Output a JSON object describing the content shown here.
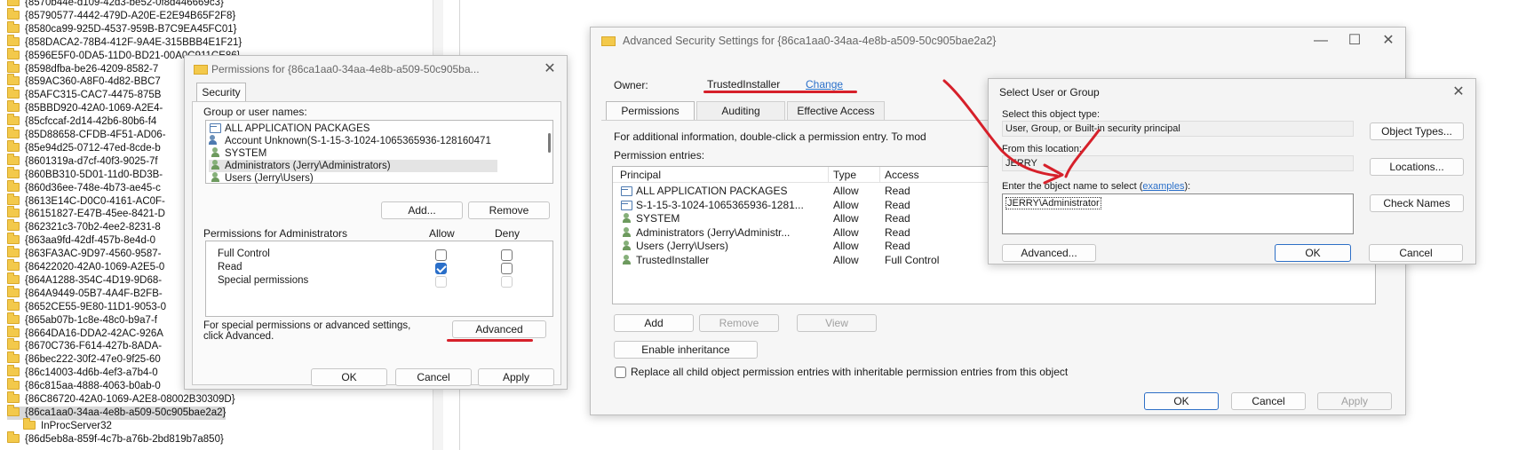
{
  "tree": {
    "rows": [
      "{8570b44e-d109-42d3-be52-0f8d446669c3}",
      "{85790577-4442-479D-A20E-E2E94B65F2F8}",
      "{8580ca99-925D-4537-959B-B7C9EA45FC01}",
      "{858DACA2-78B4-412F-9A4E-315BBB4E1F21}",
      "{8596E5F0-0DA5-11D0-BD21-00A0C911CE86}",
      "{8598dfba-be26-4209-8582-7",
      "{859AC360-A8F0-4d82-BBC7",
      "{85AFC315-CAC7-4475-875B",
      "{85BBD920-42A0-1069-A2E4-",
      "{85cfccaf-2d14-42b6-80b6-f4",
      "{85D88658-CFDB-4F51-AD06-",
      "{85e94d25-0712-47ed-8cde-b",
      "{8601319a-d7cf-40f3-9025-7f",
      "{860BB310-5D01-11d0-BD3B-",
      "{860d36ee-748e-4b73-ae45-c",
      "{8613E14C-D0C0-4161-AC0F-",
      "{86151827-E47B-45ee-8421-D",
      "{862321c3-70b2-4ee2-8231-8",
      "{863aa9fd-42df-457b-8e4d-0",
      "{863FA3AC-9D97-4560-9587-",
      "{86422020-42A0-1069-A2E5-0",
      "{864A1288-354C-4D19-9D68-",
      "{864A9449-05B7-4A4F-B2FB-",
      "{8652CE55-9E80-11D1-9053-0",
      "{865ab07b-1c8e-48c0-b9a7-f",
      "{8664DA16-DDA2-42AC-926A",
      "{8670C736-F614-427b-8ADA-",
      "{86bec222-30f2-47e0-9f25-60",
      "{86c14003-4d6b-4ef3-a7b4-0",
      "{86c815aa-4888-4063-b0ab-0",
      "{86C86720-42A0-1069-A2E8-08002B30309D}",
      "{86ca1aa0-34aa-4e8b-a509-50c905bae2a2}",
      "InProcServer32",
      "{86d5eb8a-859f-4c7b-a76b-2bd819b7a850}"
    ],
    "selected_index": 31,
    "child_index": 32
  },
  "permissions_dialog": {
    "title": "Permissions for {86ca1aa0-34aa-4e8b-a509-50c905ba...",
    "tab": "Security",
    "group_label": "Group or user names:",
    "users": [
      {
        "name": "ALL APPLICATION PACKAGES",
        "icon": "package-icon"
      },
      {
        "name": "Account Unknown(S-1-15-3-1024-1065365936-128160471",
        "icon": "user-icon"
      },
      {
        "name": "SYSTEM",
        "icon": "group-icon"
      },
      {
        "name": "Administrators (Jerry\\Administrators)",
        "icon": "group-icon"
      },
      {
        "name": "Users (Jerry\\Users)",
        "icon": "group-icon"
      }
    ],
    "add_label": "Add...",
    "remove_label": "Remove",
    "perm_header": "Permissions for Administrators",
    "allow_header": "Allow",
    "deny_header": "Deny",
    "permissions": [
      {
        "name": "Full Control",
        "allow": false,
        "deny": false,
        "dim": false
      },
      {
        "name": "Read",
        "allow": true,
        "deny": false,
        "dim": false
      },
      {
        "name": "Special permissions",
        "allow": false,
        "deny": false,
        "dim": true
      }
    ],
    "special_text_1": "For special permissions or advanced settings,",
    "special_text_2": "click Advanced.",
    "advanced_label": "Advanced",
    "ok_label": "OK",
    "cancel_label": "Cancel",
    "apply_label": "Apply"
  },
  "advanced_dialog": {
    "title": "Advanced Security Settings for {86ca1aa0-34aa-4e8b-a509-50c905bae2a2}",
    "owner_label": "Owner:",
    "owner_value": "TrustedInstaller",
    "change_label": "Change",
    "tabs": [
      "Permissions",
      "Auditing",
      "Effective Access"
    ],
    "info_text": "For additional information, double-click a permission entry. To mod",
    "entries_label": "Permission entries:",
    "columns": [
      "Principal",
      "Type",
      "Access"
    ],
    "entries": [
      {
        "principal": "ALL APPLICATION PACKAGES",
        "type": "Allow",
        "access": "Read",
        "icon": "package-icon"
      },
      {
        "principal": "S-1-15-3-1024-1065365936-1281...",
        "type": "Allow",
        "access": "Read",
        "icon": "package-icon"
      },
      {
        "principal": "SYSTEM",
        "type": "Allow",
        "access": "Read",
        "icon": "group-icon"
      },
      {
        "principal": "Administrators (Jerry\\Administr...",
        "type": "Allow",
        "access": "Read",
        "icon": "group-icon"
      },
      {
        "principal": "Users (Jerry\\Users)",
        "type": "Allow",
        "access": "Read",
        "icon": "group-icon"
      },
      {
        "principal": "TrustedInstaller",
        "type": "Allow",
        "access": "Full Control",
        "icon": "group-icon"
      }
    ],
    "add_label": "Add",
    "remove_label": "Remove",
    "view_label": "View",
    "enable_inheritance_label": "Enable inheritance",
    "replace_label": "Replace all child object permission entries with inheritable permission entries from this object",
    "ok_label": "OK",
    "cancel_label": "Cancel",
    "apply_label": "Apply"
  },
  "select_dialog": {
    "title": "Select User or Group",
    "type_label": "Select this object type:",
    "type_value": "User, Group, or Built-in security principal",
    "object_types_label": "Object Types...",
    "location_label": "From this location:",
    "location_value": "JERRY",
    "locations_label": "Locations...",
    "enter_label_prefix": "Enter the object name to select (",
    "examples_label": "examples",
    "enter_label_suffix": "):",
    "object_name_value": "JERRY\\Administrator",
    "check_names_label": "Check Names",
    "advanced_label": "Advanced...",
    "ok_label": "OK",
    "cancel_label": "Cancel"
  },
  "colors": {
    "annotation": "#d6202a",
    "accent": "#2a6fc9",
    "dialog_bg": "#f3f3f3"
  }
}
